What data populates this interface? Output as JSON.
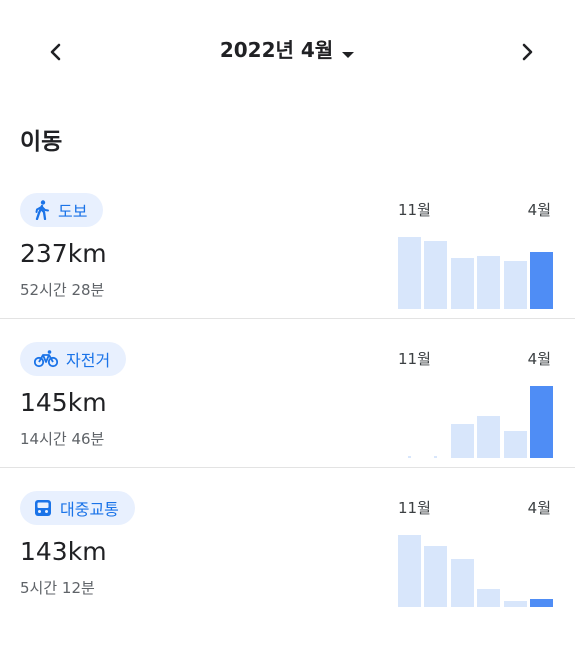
{
  "header": {
    "prev_icon": "chevron-left-icon",
    "next_icon": "chevron-right-icon",
    "month_title": "2022년 4월",
    "dropdown_icon": "caret-down-icon"
  },
  "section_title": "이동",
  "colors": {
    "accent": "#1a73e8",
    "chip_bg": "#e8f0fe",
    "bar_past": "#d8e6fb",
    "bar_current": "#4f8df5"
  },
  "activities": [
    {
      "icon": "walking-icon",
      "label": "도보",
      "distance": "237km",
      "duration": "52시간 28분",
      "axis_start": "11월",
      "axis_end": "4월",
      "chart_data": {
        "type": "bar",
        "values": [
          1.0,
          0.95,
          0.71,
          0.73,
          0.66,
          0.79
        ],
        "ylim": [
          0,
          1
        ]
      }
    },
    {
      "icon": "bicycle-icon",
      "label": "자전거",
      "distance": "145km",
      "duration": "14시간 46분",
      "axis_start": "11월",
      "axis_end": "4월",
      "chart_data": {
        "type": "bar",
        "values": [
          0.0,
          0.0,
          0.47,
          0.58,
          0.37,
          1.0
        ],
        "ylim": [
          0,
          1
        ]
      }
    },
    {
      "icon": "transit-icon",
      "label": "대중교통",
      "distance": "143km",
      "duration": "5시간 12분",
      "axis_start": "11월",
      "axis_end": "4월",
      "chart_data": {
        "type": "bar",
        "values": [
          1.0,
          0.85,
          0.67,
          0.25,
          0.08,
          0.11
        ],
        "ylim": [
          0,
          1
        ]
      }
    }
  ]
}
